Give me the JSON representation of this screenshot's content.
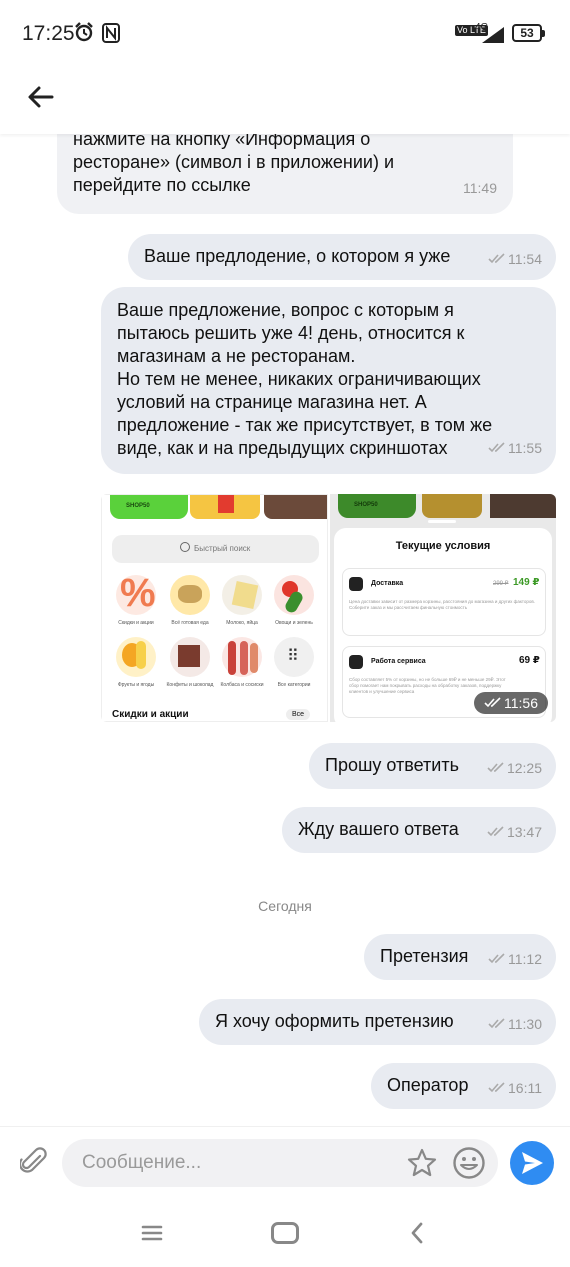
{
  "status_bar": {
    "time": "17:25",
    "network": "4G",
    "volte": "Vo LTE",
    "battery": "53"
  },
  "header": {
    "back_icon": "arrow-left-icon"
  },
  "messages": [
    {
      "dir": "in",
      "text": "нажмите на кнопку «Информация о\nресторане» (символ i в приложении) и\nперейдите по ссылке",
      "time": "11:49"
    },
    {
      "dir": "out",
      "text": "Ваше предлодение, о котором я уже",
      "time": "11:54"
    },
    {
      "dir": "out",
      "text": "Ваше предложение, вопрос с которым я\nпытаюсь решить уже 4! день, относится к\nмагазинам а не ресторанам.\nНо тем не менее, никаких ограничивающих\nусловий на странице магазина нет. А\nпредложение - так же присутствует, в том же\nвиде, как и на предыдущих скриншотах",
      "time": "11:55"
    },
    {
      "dir": "out",
      "type": "images",
      "time": "11:56"
    },
    {
      "dir": "out",
      "text": "Прошу ответить",
      "time": "12:25"
    },
    {
      "dir": "out",
      "text": "Жду вашего ответа",
      "time": "13:47"
    },
    {
      "dir": "out",
      "text": "Претензия",
      "time": "11:12"
    },
    {
      "dir": "out",
      "text": "Я хочу оформить претензию",
      "time": "11:30"
    },
    {
      "dir": "out",
      "text": "Оператор",
      "time": "16:11"
    }
  ],
  "day_separator": "Сегодня",
  "screenshot_left": {
    "promo": "SHOP50",
    "search_placeholder": "Быстрый поиск",
    "categories": [
      "Скидки и акции",
      "Всё готовая еда",
      "Молоко, яйца",
      "Овощи и зелень",
      "Фрукты и ягоды",
      "Конфеты и шоколад",
      "Колбаса и сосиски",
      "Все категории"
    ],
    "section_title": "Скидки и акции",
    "section_link": "Все"
  },
  "screenshot_right": {
    "promo": "SHOP50",
    "title": "Текущие условия",
    "delivery_label": "Доставка",
    "delivery_old": "299 ₽",
    "delivery_price": "149 ₽",
    "delivery_note": "Цена доставки зависит от размера корзины, расстояния до магазина и других факторов. Соберите заказ и мы рассчитаем финальную стоимость",
    "service_label": "Работа сервиса",
    "service_price": "69 ₽",
    "service_note": "Сбор составляет 5% от корзины, но не больше 69₽ и не меньше 29₽. Этот сбор помогает нам покрывать расходы на обработку заказов, поддержку клиентов и улучшение сервиса"
  },
  "composer": {
    "placeholder": "Сообщение..."
  },
  "colors": {
    "accent": "#2f8cf2",
    "bubble_out": "#e8ebf1",
    "bubble_in": "#f0f1f4",
    "promo_green": "#5ad13b"
  }
}
